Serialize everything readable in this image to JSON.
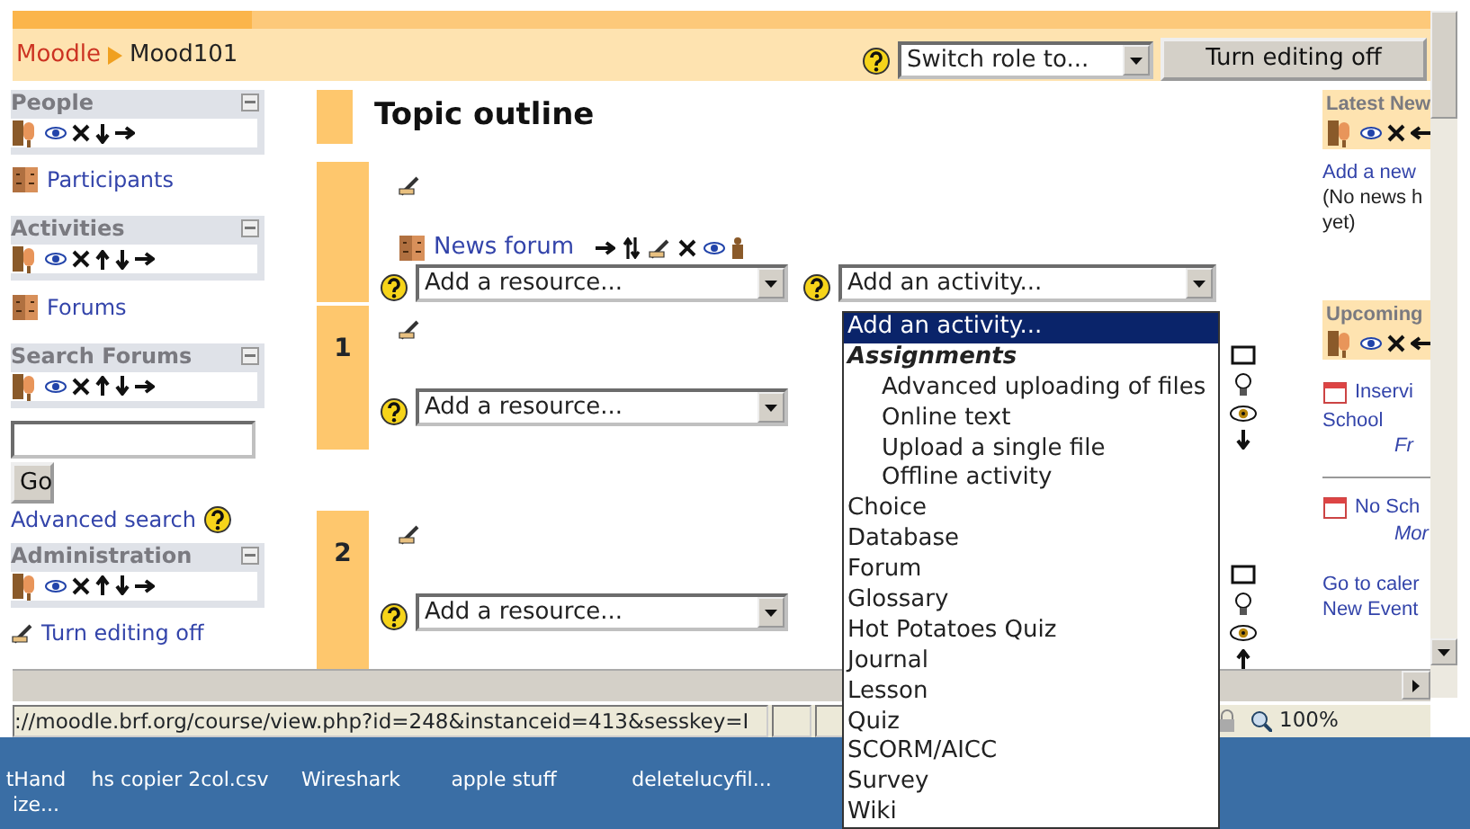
{
  "header": {
    "breadcrumb": [
      {
        "label": "Moodle",
        "kind": "link"
      },
      {
        "label": "Mood101",
        "kind": "current"
      }
    ],
    "role_select": {
      "value": "Switch role to..."
    },
    "editing_button": "Turn editing off"
  },
  "left_blocks": [
    {
      "title": "People",
      "controls": [
        {
          "kind": "roles"
        },
        {
          "kind": "hide"
        },
        {
          "kind": "delete"
        },
        {
          "kind": "down"
        },
        {
          "kind": "right"
        }
      ],
      "kind": "links",
      "links": [
        {
          "label": "Participants",
          "kind": "roster"
        }
      ]
    },
    {
      "title": "Activities",
      "controls": [
        {
          "kind": "roles"
        },
        {
          "kind": "hide"
        },
        {
          "kind": "delete"
        },
        {
          "kind": "up"
        },
        {
          "kind": "down"
        },
        {
          "kind": "right"
        }
      ],
      "kind": "links",
      "links": [
        {
          "label": "Forums",
          "kind": "roster"
        }
      ]
    },
    {
      "title": "Search Forums",
      "controls": [
        {
          "kind": "roles"
        },
        {
          "kind": "hide"
        },
        {
          "kind": "delete"
        },
        {
          "kind": "up"
        },
        {
          "kind": "down"
        },
        {
          "kind": "right"
        }
      ],
      "kind": "search",
      "button": "Go",
      "advanced": "Advanced search"
    },
    {
      "title": "Administration",
      "controls": [
        {
          "kind": "roles"
        },
        {
          "kind": "hide"
        },
        {
          "kind": "delete"
        },
        {
          "kind": "up"
        },
        {
          "kind": "down"
        },
        {
          "kind": "right"
        }
      ],
      "kind": "links",
      "links": [
        {
          "label": "Turn editing off",
          "kind": "editing"
        }
      ]
    }
  ],
  "main": {
    "title": "Topic outline",
    "sections": [
      {
        "activities": [
          {
            "label": "News forum",
            "controls": [
              {
                "kind": "right"
              },
              {
                "kind": "move"
              },
              {
                "kind": "edit"
              },
              {
                "kind": "delete"
              },
              {
                "kind": "hide"
              },
              {
                "kind": "group"
              }
            ]
          }
        ],
        "resource": "Add a resource...",
        "activity": "Add an activity..."
      },
      {
        "number": "1",
        "resource": "Add a resource...",
        "side_controls": [
          {
            "kind": "highlight"
          },
          {
            "kind": "bulb"
          },
          {
            "kind": "hide"
          },
          {
            "kind": "down"
          }
        ]
      },
      {
        "number": "2",
        "resource": "Add a resource...",
        "side_controls": [
          {
            "kind": "highlight"
          },
          {
            "kind": "bulb"
          },
          {
            "kind": "hide"
          },
          {
            "kind": "up"
          }
        ]
      }
    ]
  },
  "activity_menu": [
    {
      "label": "Add an activity...",
      "kind": "option",
      "selected": true
    },
    {
      "label": "Assignments",
      "kind": "group",
      "selected": false
    },
    {
      "label": "Advanced uploading of files",
      "kind": "suboption",
      "selected": false
    },
    {
      "label": "Online text",
      "kind": "suboption",
      "selected": false
    },
    {
      "label": "Upload a single file",
      "kind": "suboption",
      "selected": false
    },
    {
      "label": "Offline activity",
      "kind": "suboption",
      "selected": false
    },
    {
      "label": "Choice",
      "kind": "option",
      "selected": false
    },
    {
      "label": "Database",
      "kind": "option",
      "selected": false
    },
    {
      "label": "Forum",
      "kind": "option",
      "selected": false
    },
    {
      "label": "Glossary",
      "kind": "option",
      "selected": false
    },
    {
      "label": "Hot Potatoes Quiz",
      "kind": "option",
      "selected": false
    },
    {
      "label": "Journal",
      "kind": "option",
      "selected": false
    },
    {
      "label": "Lesson",
      "kind": "option",
      "selected": false
    },
    {
      "label": "Quiz",
      "kind": "option",
      "selected": false
    },
    {
      "label": "SCORM/AICC",
      "kind": "option",
      "selected": false
    },
    {
      "label": "Survey",
      "kind": "option",
      "selected": false
    },
    {
      "label": "Wiki",
      "kind": "option",
      "selected": false
    }
  ],
  "right_blocks": [
    {
      "title": "Latest New",
      "controls": [
        {
          "kind": "roles"
        },
        {
          "kind": "hide"
        },
        {
          "kind": "delete"
        },
        {
          "kind": "left"
        }
      ],
      "lines": [
        {
          "text": "Add a new",
          "kind": "link"
        },
        {
          "text": "(No news h",
          "kind": "plain"
        },
        {
          "text": "yet)",
          "kind": "plain"
        }
      ]
    },
    {
      "title": "Upcoming",
      "controls": [
        {
          "kind": "roles"
        },
        {
          "kind": "hide"
        },
        {
          "kind": "delete"
        },
        {
          "kind": "left"
        }
      ],
      "lines": [
        {
          "text": "Inservi",
          "kind": "event"
        },
        {
          "text": "School",
          "kind": "link"
        },
        {
          "text": "Fr",
          "kind": "date"
        },
        {
          "kind": "divider"
        },
        {
          "text": "No Sch",
          "kind": "event"
        },
        {
          "text": "Mor",
          "kind": "date"
        },
        {
          "text": "Go to caler",
          "kind": "spaced-link"
        },
        {
          "text": "New Event",
          "kind": "link"
        }
      ]
    }
  ],
  "status_bar": {
    "url": "://moodle.brf.org/course/view.php?id=248&instanceid=413&sesskey=I",
    "zoom": "100%"
  },
  "desktop_icons": [
    {
      "label": "tHand ize..."
    },
    {
      "label": "hs copier 2col.csv"
    },
    {
      "label": "Wireshark"
    },
    {
      "label": "apple stuff"
    },
    {
      "label": "deletelucyfil..."
    }
  ]
}
